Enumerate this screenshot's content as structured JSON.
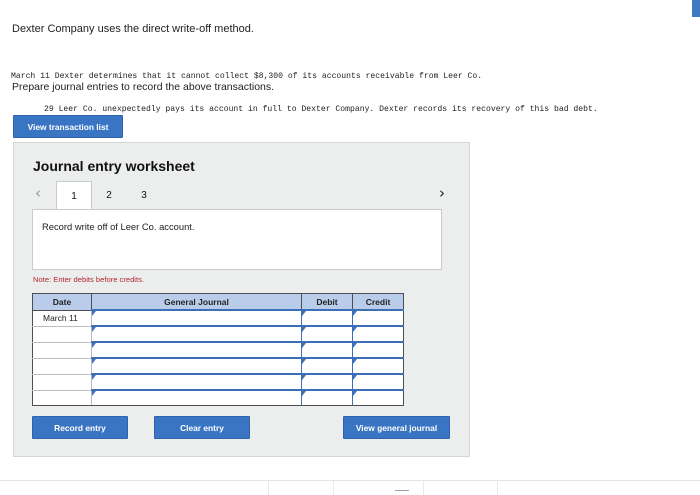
{
  "intro": "Dexter Company uses the direct write-off method.",
  "problem": {
    "line1": "March 11 Dexter determines that it cannot collect $8,300 of its accounts receivable from Leer Co.",
    "line2": "29 Leer Co. unexpectedly pays its account in full to Dexter Company. Dexter records its recovery of this bad debt."
  },
  "instructions": "Prepare journal entries to record the above transactions.",
  "buttons": {
    "view_transaction_list": "View transaction list",
    "record_entry": "Record entry",
    "clear_entry": "Clear entry",
    "view_general_journal": "View general journal"
  },
  "worksheet": {
    "title": "Journal entry worksheet",
    "tabs": [
      "1",
      "2",
      "3"
    ],
    "active_tab": "1",
    "description": "Record write off of Leer Co. account.",
    "note": "Note: Enter debits before credits."
  },
  "table": {
    "headers": {
      "date": "Date",
      "journal": "General Journal",
      "debit": "Debit",
      "credit": "Credit"
    },
    "rows": [
      {
        "date": "March 11",
        "account": "",
        "debit": "",
        "credit": ""
      },
      {
        "date": "",
        "account": "",
        "debit": "",
        "credit": ""
      },
      {
        "date": "",
        "account": "",
        "debit": "",
        "credit": ""
      },
      {
        "date": "",
        "account": "",
        "debit": "",
        "credit": ""
      },
      {
        "date": "",
        "account": "",
        "debit": "",
        "credit": ""
      },
      {
        "date": "",
        "account": "",
        "debit": "",
        "credit": ""
      }
    ]
  },
  "colors": {
    "button_blue": "#3a75c4",
    "table_header": "#b9cdea",
    "note_red": "#b3272f",
    "panel_bg": "#eceded"
  },
  "icons": [
    "chevron-left-icon",
    "chevron-right-icon"
  ]
}
